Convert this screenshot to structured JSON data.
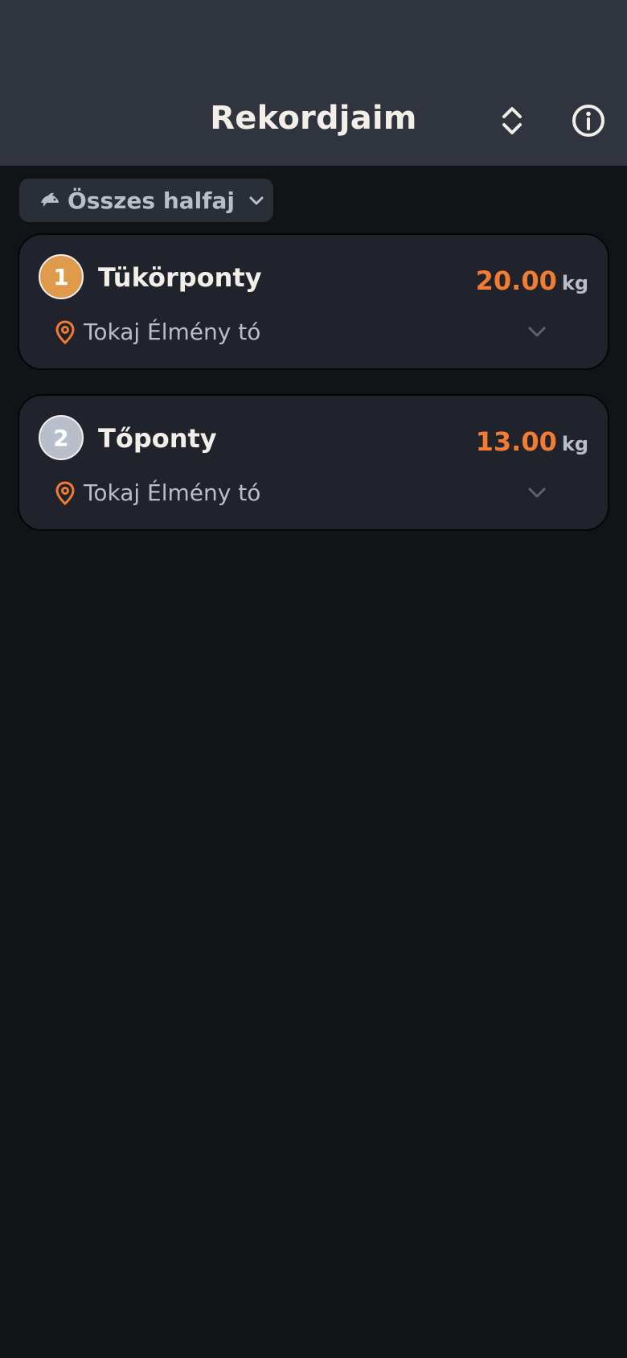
{
  "header": {
    "title": "Rekordjaim",
    "sort_icon": "sort-updown-icon",
    "info_icon": "info-icon"
  },
  "filter": {
    "label": "Összes halfaj",
    "icon": "fish-icon",
    "dropdown_icon": "chevron-down-icon"
  },
  "records": [
    {
      "rank": "1",
      "species": "Tükörponty",
      "weight": "20.00",
      "unit": "kg",
      "location": "Tokaj Élmény tó",
      "badge": "gold"
    },
    {
      "rank": "2",
      "species": "Tőponty",
      "weight": "13.00",
      "unit": "kg",
      "location": "Tokaj Élmény tó",
      "badge": "silver"
    }
  ],
  "colors": {
    "header_bg": "#30343e",
    "page_bg": "#121317",
    "card_bg": "#20232b",
    "accent": "#f47c32",
    "gold": "#e09a4c",
    "silver": "#b9bfca",
    "muted_text": "#b9bec8"
  }
}
